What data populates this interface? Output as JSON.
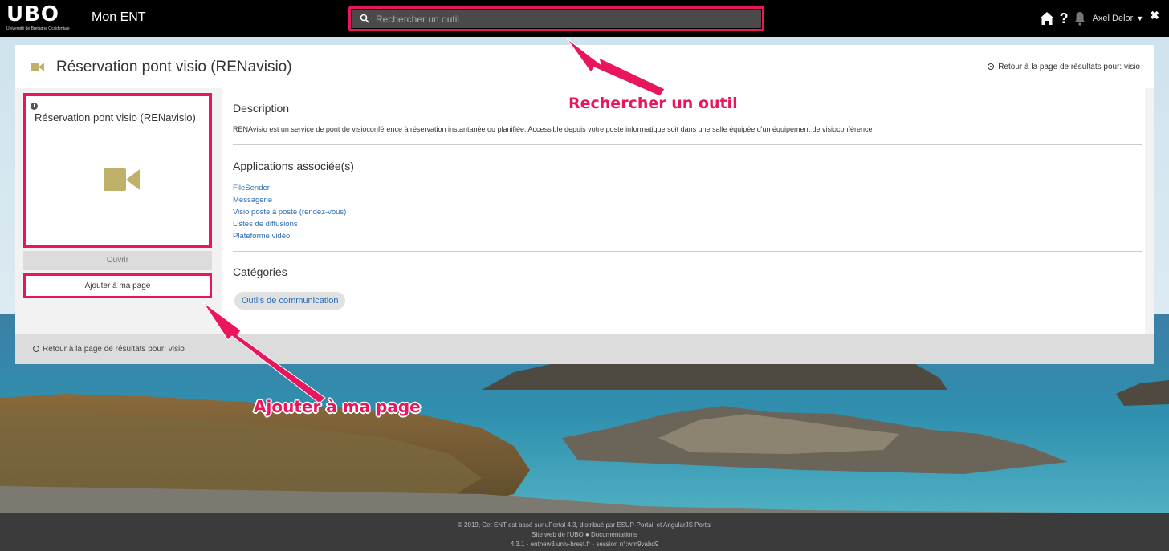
{
  "topbar": {
    "logo_text": "UBO",
    "logo_subtitle": "Université de Bretagne Occidentale",
    "app_title": "Mon ENT",
    "search_placeholder": "Rechercher un outil",
    "user_name": "Axel Delor"
  },
  "panel": {
    "title": "Réservation pont visio (RENavisio)",
    "return_link": "Retour à la page de résultats pour: visio",
    "card": {
      "info_glyph": "i",
      "title": "Réservation pont visio (RENavisio)",
      "open_label": "Ouvrir",
      "add_label": "Ajouter à ma page"
    },
    "description": {
      "heading": "Description",
      "text": "RENAvisio est un service de pont de visioconférence à réservation instantanée ou planifiée. Accessible depuis votre poste informatique soit dans une salle équipée d'un équipement de visioconférence"
    },
    "apps": {
      "heading": "Applications associée(s)",
      "items": [
        "FileSender",
        "Messagerie",
        "Visio poste à poste (rendez-vous)",
        "Listes de diffusions",
        "Plateforme vidéo"
      ]
    },
    "categories": {
      "heading": "Catégories",
      "items": [
        "Outils de communication"
      ]
    }
  },
  "annotations": {
    "search_label": "Rechercher un outil",
    "add_label": "Ajouter à ma page"
  },
  "footer": {
    "line1": "© 2019, Cet ENT est basé sur uPortal 4.3, distribué par ESUP-Portail et AngularJS Portal",
    "line2": "Site web de l'UBO ● Documentations",
    "line3": "4.3.1 - entnew3.univ-brest.fr - session n°:wm9vabd9"
  },
  "colors": {
    "highlight": "#e8175d",
    "icon_gold": "#bfb06a",
    "link": "#2a6db5"
  }
}
